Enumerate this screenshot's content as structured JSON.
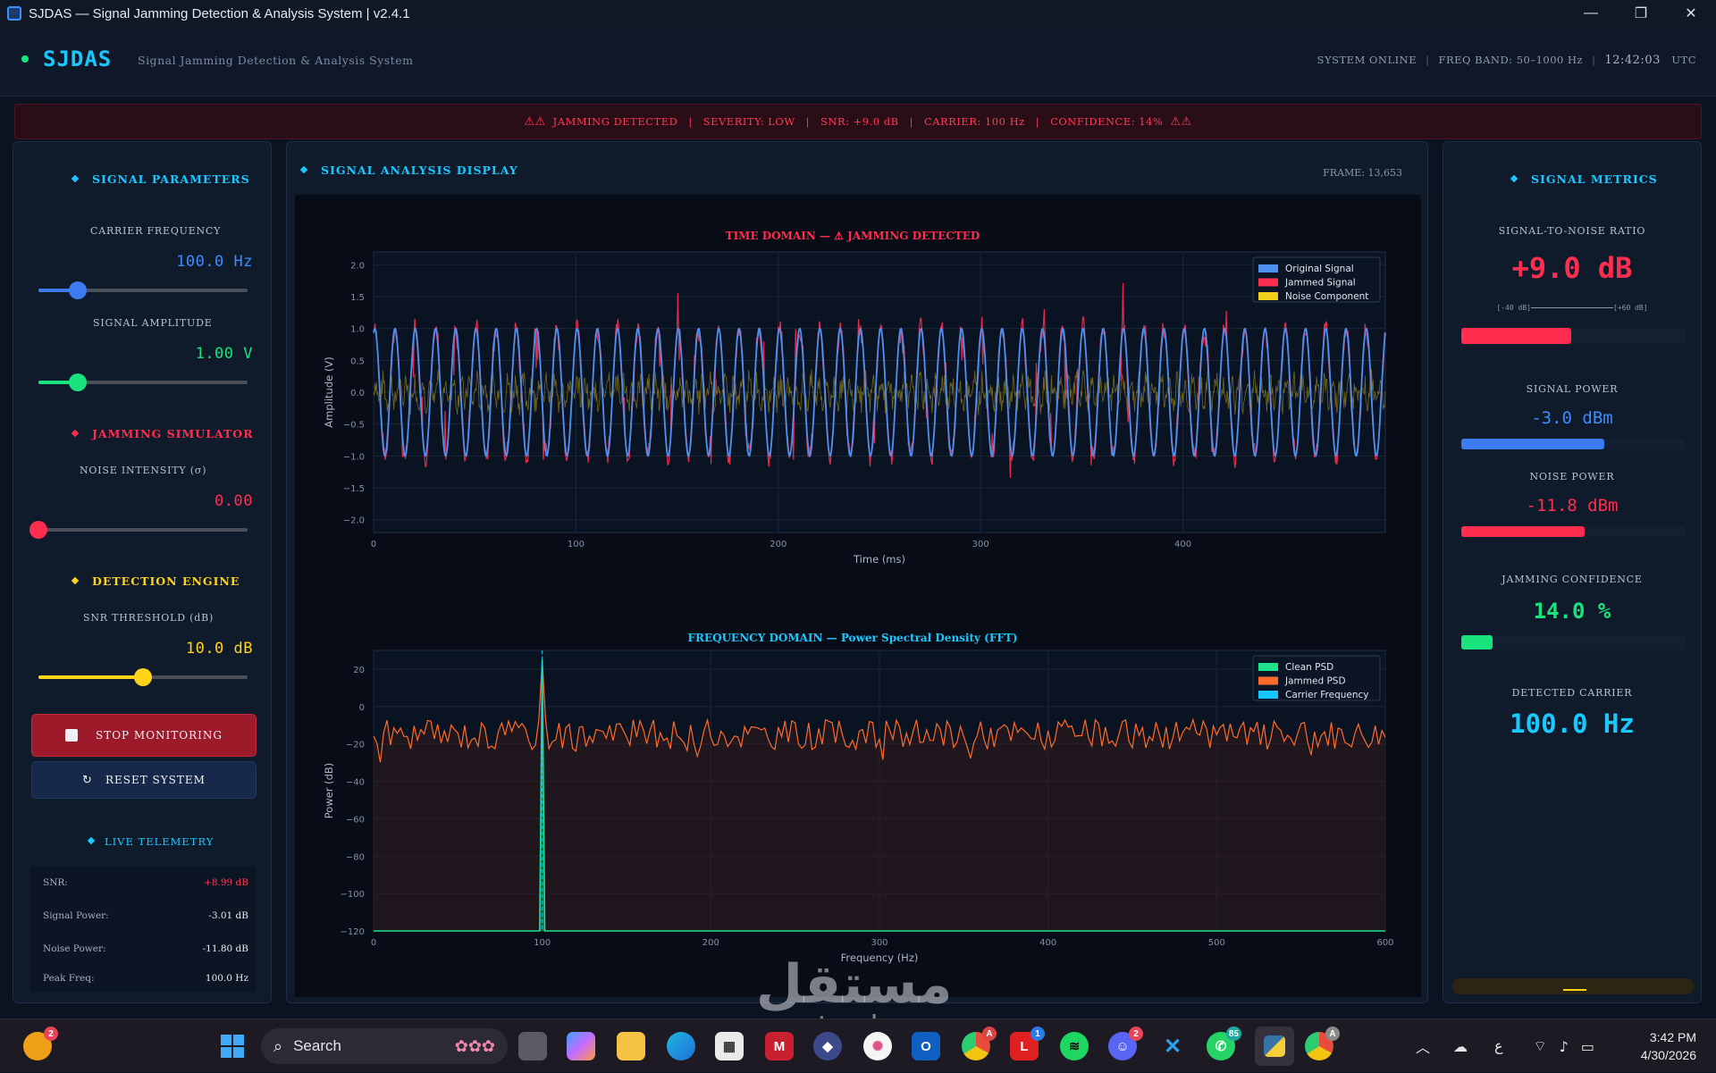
{
  "window": {
    "title": "SJDAS — Signal Jamming Detection & Analysis System  |  v2.4.1",
    "minimize": "—",
    "restore": "❐",
    "close": "✕"
  },
  "header": {
    "logo": "SJDAS",
    "subtitle": "Signal Jamming Detection & Analysis System",
    "status_online": "SYSTEM ONLINE",
    "freq_band": "FREQ BAND: 50–1000 Hz",
    "time": "12:42:03",
    "timezone": "UTC",
    "sep": "|"
  },
  "alert": {
    "warn": "⚠⚠",
    "status": "JAMMING DETECTED",
    "severity": "SEVERITY: LOW",
    "snr": "SNR: +9.0 dB",
    "carrier": "CARRIER: 100 Hz",
    "confidence": "CONFIDENCE: 14%",
    "sep": "|"
  },
  "left": {
    "signal_params_title": "SIGNAL PARAMETERS",
    "carrier_label": "CARRIER FREQUENCY",
    "carrier_value": "100.0 Hz",
    "carrier_level": 0.19,
    "amplitude_label": "SIGNAL AMPLITUDE",
    "amplitude_value": "1.00 V",
    "amplitude_level": 0.19,
    "jamming_title": "JAMMING SIMULATOR",
    "noise_label": "NOISE INTENSITY  (σ)",
    "noise_value": "0.00",
    "noise_level": 0.0,
    "detection_title": "DETECTION ENGINE",
    "snr_label": "SNR THRESHOLD  (dB)",
    "snr_value": "10.0 dB",
    "snr_level": 0.5,
    "stop_button": "STOP MONITORING",
    "reset_button": "RESET SYSTEM",
    "telemetry_title": "LIVE TELEMETRY",
    "telemetry": [
      {
        "label": "SNR:",
        "value": "+8.99 dB"
      },
      {
        "label": "Signal Power:",
        "value": "-3.01 dB"
      },
      {
        "label": "Noise Power:",
        "value": "-11.80 dB"
      },
      {
        "label": "Peak Freq:",
        "value": "100.0 Hz"
      }
    ]
  },
  "center": {
    "title": "SIGNAL ANALYSIS DISPLAY",
    "frame": "FRAME: 13,653"
  },
  "chart_data": [
    {
      "type": "line",
      "title": "TIME DOMAIN  —  ⚠  JAMMING DETECTED",
      "xlabel": "Time (ms)",
      "ylabel": "Amplitude (V)",
      "xlim": [
        0,
        500
      ],
      "ylim": [
        -2.2,
        2.2
      ],
      "xticks": [
        0,
        100,
        200,
        300,
        400
      ],
      "yticks": [
        2.0,
        1.5,
        1.0,
        0.5,
        0.0,
        -0.5,
        -1.0,
        -1.5,
        -2.0
      ],
      "grid": true,
      "legend": "top-right",
      "series": [
        {
          "name": "Original Signal",
          "color": "#4f8ff0",
          "frequency_hz": 100,
          "amplitude": 1.0
        },
        {
          "name": "Jammed Signal",
          "color": "#ff2d4e",
          "frequency_hz": 100,
          "amplitude": 1.0,
          "noise_peak": 0.7
        },
        {
          "name": "Noise Component",
          "color": "#f3cf1d",
          "amplitude": 0.35
        }
      ]
    },
    {
      "type": "area",
      "title": "FREQUENCY DOMAIN  —  Power Spectral Density (FFT)",
      "xlabel": "Frequency (Hz)",
      "ylabel": "Power (dB)",
      "xlim": [
        0,
        600
      ],
      "ylim": [
        -120,
        30
      ],
      "xticks": [
        0,
        100,
        200,
        300,
        400,
        500,
        600
      ],
      "yticks": [
        20,
        0,
        -20,
        -40,
        -60,
        -80,
        -100,
        -120
      ],
      "grid": true,
      "legend": "top-right",
      "series": [
        {
          "name": "Clean PSD",
          "color": "#1ee38a",
          "peak_x": 100,
          "peak_y": 25,
          "floor": -120
        },
        {
          "name": "Jammed PSD",
          "color": "#ff6a2a",
          "peak_x": 100,
          "peak_y": 25,
          "baseline": -15
        },
        {
          "name": "Carrier Frequency",
          "color": "#16c8ff",
          "x": 100
        }
      ]
    }
  ],
  "right": {
    "title": "SIGNAL METRICS",
    "snr_label": "SIGNAL-TO-NOISE RATIO",
    "snr_value": "+9.0 dB",
    "snr_scale_left": "[-40 dB]",
    "snr_scale_right": "[+60 dB]",
    "snr_level": 0.49,
    "power_label": "SIGNAL POWER",
    "power_value": "-3.0 dBm",
    "power_level": 0.64,
    "noise_label": "NOISE POWER",
    "noise_value": "-11.8 dBm",
    "noise_level": 0.55,
    "conf_label": "JAMMING CONFIDENCE",
    "conf_value": "14.0 %",
    "conf_level": 0.14,
    "carrier_label": "DETECTED CARRIER",
    "carrier_value": "100.0 Hz"
  },
  "colors": {
    "accent": "#19c8ff",
    "danger": "#ff2d4e",
    "success": "#19e37d",
    "warning": "#ffd31a",
    "blue": "#3d7cf0"
  },
  "taskbar": {
    "search": "Search",
    "clock_time": "3:42 PM",
    "clock_date": "4/30/2026",
    "lang": "ع",
    "badges": {
      "widgets": "2",
      "chrome": "A",
      "l_app": "1",
      "discord": "2",
      "whatsapp": "85",
      "chrome2": "A"
    }
  },
  "watermark": {
    "arabic": "مستقل",
    "latin": "mostaql.com"
  }
}
